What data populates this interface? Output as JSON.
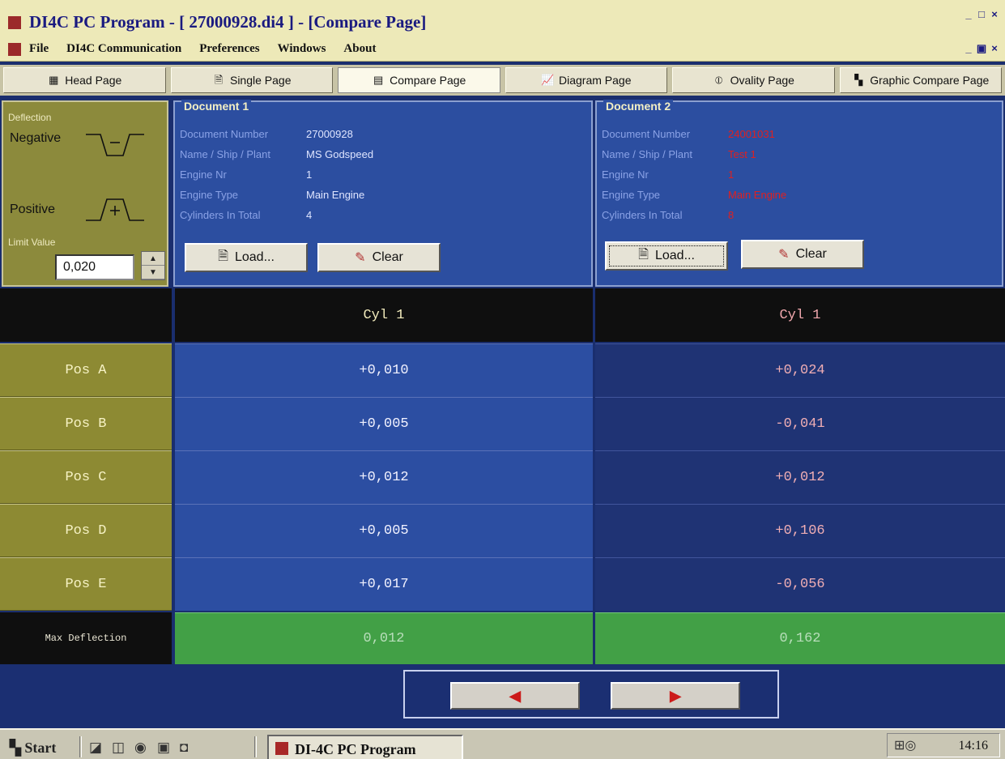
{
  "window": {
    "title_prefix": "DI4C PC Program - [ ",
    "file": "27000928.di4",
    "title_suffix": " ] - [Compare Page]",
    "minimize": "_",
    "maximize": "□",
    "close": "×",
    "restore": "▣"
  },
  "menu": [
    {
      "label": "File"
    },
    {
      "label": "DI4C Communication"
    },
    {
      "label": "Preferences"
    },
    {
      "label": "Windows"
    },
    {
      "label": "About"
    }
  ],
  "tabs": [
    {
      "label": "Head Page",
      "icon": "▦"
    },
    {
      "label": "Single Page",
      "icon": "🗎"
    },
    {
      "label": "Compare Page",
      "icon": "▤"
    },
    {
      "label": "Diagram Page",
      "icon": "📈"
    },
    {
      "label": "Ovality Page",
      "icon": "⦶"
    },
    {
      "label": "Graphic Compare Page",
      "icon": "▚"
    }
  ],
  "deflection": {
    "group_label": "Deflection",
    "negative": "Negative",
    "positive": "Positive",
    "limit_label": "Limit Value",
    "limit_value": "0,020",
    "spin_up": "▲",
    "spin_down": "▼"
  },
  "doc1": {
    "title": "Document 1",
    "fields": [
      {
        "label": "Document Number",
        "value": "27000928"
      },
      {
        "label": "Name / Ship / Plant",
        "value": "MS Godspeed"
      },
      {
        "label": "Engine Nr",
        "value": "1"
      },
      {
        "label": "Engine Type",
        "value": "Main Engine"
      },
      {
        "label": "Cylinders In Total",
        "value": "4"
      }
    ],
    "load": "Load...",
    "clear": "Clear"
  },
  "doc2": {
    "title": "Document 2",
    "fields": [
      {
        "label": "Document Number",
        "value": "24001031"
      },
      {
        "label": "Name / Ship / Plant",
        "value": "Test 1"
      },
      {
        "label": "Engine Nr",
        "value": "1"
      },
      {
        "label": "Engine Type",
        "value": "Main Engine"
      },
      {
        "label": "Cylinders In Total",
        "value": "8"
      }
    ],
    "load": "Load...",
    "clear": "Clear"
  },
  "grid": {
    "col1": "Cyl 1",
    "col2": "Cyl 1",
    "rows": [
      {
        "pos": "Pos A",
        "v1": "+0,010",
        "v2": "+0,024"
      },
      {
        "pos": "Pos B",
        "v1": "+0,005",
        "v2": "-0,041"
      },
      {
        "pos": "Pos C",
        "v1": "+0,012",
        "v2": "+0,012"
      },
      {
        "pos": "Pos D",
        "v1": "+0,005",
        "v2": "+0,106"
      },
      {
        "pos": "Pos E",
        "v1": "+0,017",
        "v2": "-0,056"
      }
    ],
    "max_label": "Max Deflection",
    "max1": "0,012",
    "max2": "0,162"
  },
  "nav": {
    "prev": "◀",
    "next": "▶"
  },
  "taskbar": {
    "start": "Start",
    "task": "DI-4C PC Program",
    "clock": "14:16"
  }
}
